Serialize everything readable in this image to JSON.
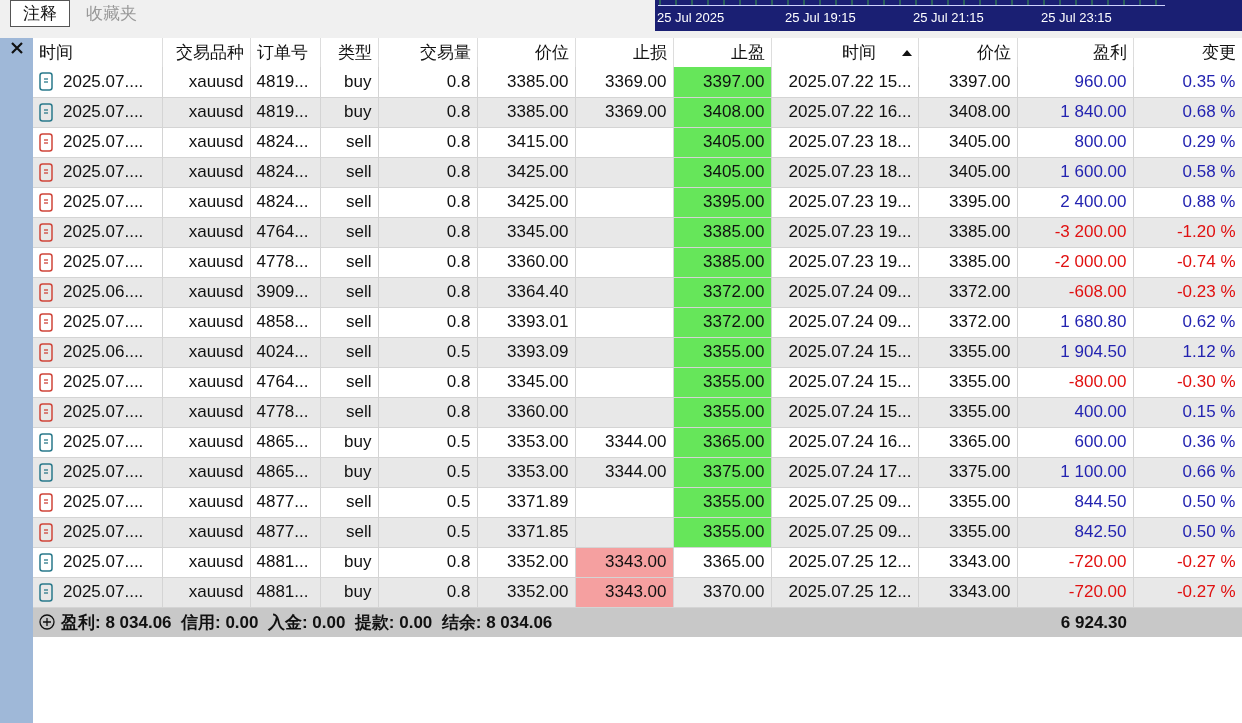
{
  "tabs": [
    {
      "label": "注释",
      "selected": true
    },
    {
      "label": "收藏夹",
      "selected": false
    }
  ],
  "chart_strip": {
    "labels": [
      "25 Jul 2025",
      "25 Jul 19:15",
      "25 Jul 21:15",
      "25 Jul 23:15"
    ]
  },
  "table": {
    "columns": [
      {
        "label": "时间",
        "sorted": false
      },
      {
        "label": "交易品种",
        "sorted": false
      },
      {
        "label": "订单号",
        "sorted": false
      },
      {
        "label": "类型",
        "sorted": false
      },
      {
        "label": "交易量",
        "sorted": false
      },
      {
        "label": "价位",
        "sorted": false
      },
      {
        "label": "止损",
        "sorted": false
      },
      {
        "label": "止盈",
        "sorted": false
      },
      {
        "label": "时间",
        "sorted": true
      },
      {
        "label": "价位",
        "sorted": false
      },
      {
        "label": "盈利",
        "sorted": false
      },
      {
        "label": "变更",
        "sorted": false
      }
    ],
    "rows": [
      {
        "kind": "buy",
        "cells": [
          "2025.07....",
          "xauusd",
          "4819...",
          "buy",
          "0.8",
          "3385.00",
          "3369.00",
          "3397.00",
          "2025.07.22 15...",
          "3397.00",
          "960.00",
          "0.35 %"
        ],
        "tp_hit": true,
        "sl_hit": false,
        "loss": false
      },
      {
        "kind": "buy",
        "cells": [
          "2025.07....",
          "xauusd",
          "4819...",
          "buy",
          "0.8",
          "3385.00",
          "3369.00",
          "3408.00",
          "2025.07.22 16...",
          "3408.00",
          "1 840.00",
          "0.68 %"
        ],
        "tp_hit": true,
        "sl_hit": false,
        "loss": false
      },
      {
        "kind": "sell",
        "cells": [
          "2025.07....",
          "xauusd",
          "4824...",
          "sell",
          "0.8",
          "3415.00",
          "",
          "3405.00",
          "2025.07.23 18...",
          "3405.00",
          "800.00",
          "0.29 %"
        ],
        "tp_hit": true,
        "sl_hit": false,
        "loss": false
      },
      {
        "kind": "sell",
        "cells": [
          "2025.07....",
          "xauusd",
          "4824...",
          "sell",
          "0.8",
          "3425.00",
          "",
          "3405.00",
          "2025.07.23 18...",
          "3405.00",
          "1 600.00",
          "0.58 %"
        ],
        "tp_hit": true,
        "sl_hit": false,
        "loss": false
      },
      {
        "kind": "sell",
        "cells": [
          "2025.07....",
          "xauusd",
          "4824...",
          "sell",
          "0.8",
          "3425.00",
          "",
          "3395.00",
          "2025.07.23 19...",
          "3395.00",
          "2 400.00",
          "0.88 %"
        ],
        "tp_hit": true,
        "sl_hit": false,
        "loss": false
      },
      {
        "kind": "sell",
        "cells": [
          "2025.07....",
          "xauusd",
          "4764...",
          "sell",
          "0.8",
          "3345.00",
          "",
          "3385.00",
          "2025.07.23 19...",
          "3385.00",
          "-3 200.00",
          "-1.20 %"
        ],
        "tp_hit": true,
        "sl_hit": false,
        "loss": true
      },
      {
        "kind": "sell",
        "cells": [
          "2025.07....",
          "xauusd",
          "4778...",
          "sell",
          "0.8",
          "3360.00",
          "",
          "3385.00",
          "2025.07.23 19...",
          "3385.00",
          "-2 000.00",
          "-0.74 %"
        ],
        "tp_hit": true,
        "sl_hit": false,
        "loss": true
      },
      {
        "kind": "sell",
        "cells": [
          "2025.06....",
          "xauusd",
          "3909...",
          "sell",
          "0.8",
          "3364.40",
          "",
          "3372.00",
          "2025.07.24 09...",
          "3372.00",
          "-608.00",
          "-0.23 %"
        ],
        "tp_hit": true,
        "sl_hit": false,
        "loss": true
      },
      {
        "kind": "sell",
        "cells": [
          "2025.07....",
          "xauusd",
          "4858...",
          "sell",
          "0.8",
          "3393.01",
          "",
          "3372.00",
          "2025.07.24 09...",
          "3372.00",
          "1 680.80",
          "0.62 %"
        ],
        "tp_hit": true,
        "sl_hit": false,
        "loss": false
      },
      {
        "kind": "sell",
        "cells": [
          "2025.06....",
          "xauusd",
          "4024...",
          "sell",
          "0.5",
          "3393.09",
          "",
          "3355.00",
          "2025.07.24 15...",
          "3355.00",
          "1 904.50",
          "1.12 %"
        ],
        "tp_hit": true,
        "sl_hit": false,
        "loss": false
      },
      {
        "kind": "sell",
        "cells": [
          "2025.07....",
          "xauusd",
          "4764...",
          "sell",
          "0.8",
          "3345.00",
          "",
          "3355.00",
          "2025.07.24 15...",
          "3355.00",
          "-800.00",
          "-0.30 %"
        ],
        "tp_hit": true,
        "sl_hit": false,
        "loss": true
      },
      {
        "kind": "sell",
        "cells": [
          "2025.07....",
          "xauusd",
          "4778...",
          "sell",
          "0.8",
          "3360.00",
          "",
          "3355.00",
          "2025.07.24 15...",
          "3355.00",
          "400.00",
          "0.15 %"
        ],
        "tp_hit": true,
        "sl_hit": false,
        "loss": false
      },
      {
        "kind": "buy",
        "cells": [
          "2025.07....",
          "xauusd",
          "4865...",
          "buy",
          "0.5",
          "3353.00",
          "3344.00",
          "3365.00",
          "2025.07.24 16...",
          "3365.00",
          "600.00",
          "0.36 %"
        ],
        "tp_hit": true,
        "sl_hit": false,
        "loss": false
      },
      {
        "kind": "buy",
        "cells": [
          "2025.07....",
          "xauusd",
          "4865...",
          "buy",
          "0.5",
          "3353.00",
          "3344.00",
          "3375.00",
          "2025.07.24 17...",
          "3375.00",
          "1 100.00",
          "0.66 %"
        ],
        "tp_hit": true,
        "sl_hit": false,
        "loss": false
      },
      {
        "kind": "sell",
        "cells": [
          "2025.07....",
          "xauusd",
          "4877...",
          "sell",
          "0.5",
          "3371.89",
          "",
          "3355.00",
          "2025.07.25 09...",
          "3355.00",
          "844.50",
          "0.50 %"
        ],
        "tp_hit": true,
        "sl_hit": false,
        "loss": false
      },
      {
        "kind": "sell",
        "cells": [
          "2025.07....",
          "xauusd",
          "4877...",
          "sell",
          "0.5",
          "3371.85",
          "",
          "3355.00",
          "2025.07.25 09...",
          "3355.00",
          "842.50",
          "0.50 %"
        ],
        "tp_hit": true,
        "sl_hit": false,
        "loss": false
      },
      {
        "kind": "buy",
        "cells": [
          "2025.07....",
          "xauusd",
          "4881...",
          "buy",
          "0.8",
          "3352.00",
          "3343.00",
          "3365.00",
          "2025.07.25 12...",
          "3343.00",
          "-720.00",
          "-0.27 %"
        ],
        "tp_hit": false,
        "sl_hit": true,
        "loss": true
      },
      {
        "kind": "buy",
        "cells": [
          "2025.07....",
          "xauusd",
          "4881...",
          "buy",
          "0.8",
          "3352.00",
          "3343.00",
          "3370.00",
          "2025.07.25 12...",
          "3343.00",
          "-720.00",
          "-0.27 %"
        ],
        "tp_hit": false,
        "sl_hit": true,
        "loss": true
      }
    ],
    "footer": {
      "summary": "盈利: 8 034.06  信用: 0.00  入金: 0.00  提款: 0.00  结余: 8 034.06",
      "total": "6 924.30"
    }
  }
}
